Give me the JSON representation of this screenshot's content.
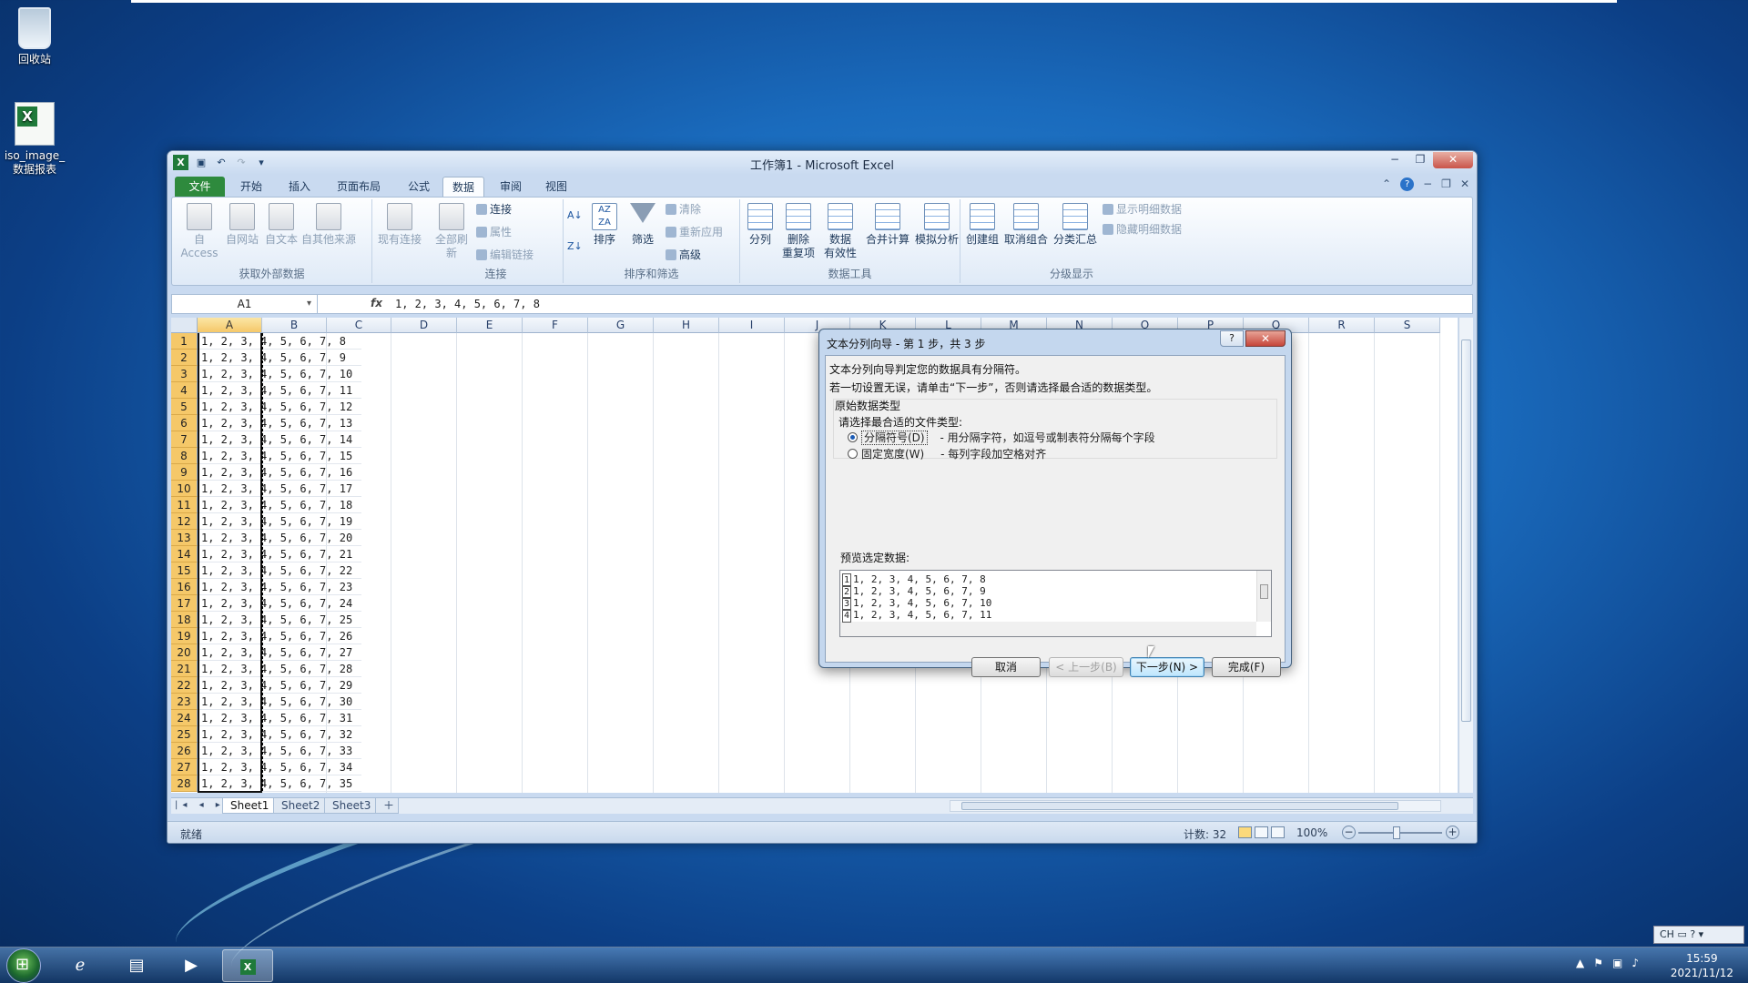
{
  "desktop": {
    "icons": [
      {
        "label": "回收站"
      },
      {
        "label": "iso_image_数据报表"
      }
    ]
  },
  "window": {
    "title": "工作簿1 - Microsoft Excel",
    "controls": {
      "minimize": "−",
      "restore": "❐",
      "close": "✕"
    }
  },
  "ribbon_tabs": {
    "file": "文件",
    "home": "开始",
    "insert": "插入",
    "page_layout": "页面布局",
    "formulas": "公式",
    "data": "数据",
    "review": "审阅",
    "view": "视图"
  },
  "ribbon": {
    "get_external": {
      "label": "获取外部数据",
      "access": "自 Access",
      "web": "自网站",
      "text": "自文本",
      "other": "自其他来源",
      "existing": "现有连接"
    },
    "connections": {
      "label": "连接",
      "refresh_all": "全部刷新",
      "connections": "连接",
      "properties": "属性",
      "edit_links": "编辑链接"
    },
    "sort_filter": {
      "label": "排序和筛选",
      "sort": "排序",
      "filter": "筛选",
      "clear": "清除",
      "reapply": "重新应用",
      "advanced": "高级"
    },
    "data_tools": {
      "label": "数据工具",
      "text_to_columns": "分列",
      "remove_dup_1": "删除",
      "remove_dup_2": "重复项",
      "validation_1": "数据",
      "validation_2": "有效性",
      "consolidate": "合并计算",
      "what_if": "模拟分析"
    },
    "outline": {
      "label": "分级显示",
      "group": "创建组",
      "ungroup": "取消组合",
      "subtotal": "分类汇总",
      "show_detail": "显示明细数据",
      "hide_detail": "隐藏明细数据"
    }
  },
  "formula_bar": {
    "name_box": "A1",
    "fx": "fx",
    "value": "1, 2, 3, 4, 5, 6, 7, 8"
  },
  "columns": [
    "A",
    "B",
    "C",
    "D",
    "E",
    "F",
    "G",
    "H",
    "I",
    "J",
    "K",
    "L",
    "M",
    "N",
    "O",
    "P",
    "Q",
    "R",
    "S"
  ],
  "rows": [
    {
      "n": "1",
      "v": "1, 2, 3, 4, 5, 6, 7, 8"
    },
    {
      "n": "2",
      "v": "1, 2, 3, 4, 5, 6, 7, 9"
    },
    {
      "n": "3",
      "v": "1, 2, 3, 4, 5, 6, 7, 10"
    },
    {
      "n": "4",
      "v": "1, 2, 3, 4, 5, 6, 7, 11"
    },
    {
      "n": "5",
      "v": "1, 2, 3, 4, 5, 6, 7, 12"
    },
    {
      "n": "6",
      "v": "1, 2, 3, 4, 5, 6, 7, 13"
    },
    {
      "n": "7",
      "v": "1, 2, 3, 4, 5, 6, 7, 14"
    },
    {
      "n": "8",
      "v": "1, 2, 3, 4, 5, 6, 7, 15"
    },
    {
      "n": "9",
      "v": "1, 2, 3, 4, 5, 6, 7, 16"
    },
    {
      "n": "10",
      "v": "1, 2, 3, 4, 5, 6, 7, 17"
    },
    {
      "n": "11",
      "v": "1, 2, 3, 4, 5, 6, 7, 18"
    },
    {
      "n": "12",
      "v": "1, 2, 3, 4, 5, 6, 7, 19"
    },
    {
      "n": "13",
      "v": "1, 2, 3, 4, 5, 6, 7, 20"
    },
    {
      "n": "14",
      "v": "1, 2, 3, 4, 5, 6, 7, 21"
    },
    {
      "n": "15",
      "v": "1, 2, 3, 4, 5, 6, 7, 22"
    },
    {
      "n": "16",
      "v": "1, 2, 3, 4, 5, 6, 7, 23"
    },
    {
      "n": "17",
      "v": "1, 2, 3, 4, 5, 6, 7, 24"
    },
    {
      "n": "18",
      "v": "1, 2, 3, 4, 5, 6, 7, 25"
    },
    {
      "n": "19",
      "v": "1, 2, 3, 4, 5, 6, 7, 26"
    },
    {
      "n": "20",
      "v": "1, 2, 3, 4, 5, 6, 7, 27"
    },
    {
      "n": "21",
      "v": "1, 2, 3, 4, 5, 6, 7, 28"
    },
    {
      "n": "22",
      "v": "1, 2, 3, 4, 5, 6, 7, 29"
    },
    {
      "n": "23",
      "v": "1, 2, 3, 4, 5, 6, 7, 30"
    },
    {
      "n": "24",
      "v": "1, 2, 3, 4, 5, 6, 7, 31"
    },
    {
      "n": "25",
      "v": "1, 2, 3, 4, 5, 6, 7, 32"
    },
    {
      "n": "26",
      "v": "1, 2, 3, 4, 5, 6, 7, 33"
    },
    {
      "n": "27",
      "v": "1, 2, 3, 4, 5, 6, 7, 34"
    },
    {
      "n": "28",
      "v": "1, 2, 3, 4, 5, 6, 7, 35"
    }
  ],
  "sheets": [
    "Sheet1",
    "Sheet2",
    "Sheet3"
  ],
  "status": {
    "ready": "就绪",
    "count": "计数: 32",
    "zoom": "100%"
  },
  "dialog": {
    "title": "文本分列向导 - 第 1 步，共 3 步",
    "help": "?",
    "close": "✕",
    "line1": "文本分列向导判定您的数据具有分隔符。",
    "line2": "若一切设置无误，请单击“下一步”，否则请选择最合适的数据类型。",
    "group_title": "原始数据类型",
    "prompt": "请选择最合适的文件类型:",
    "opt_delimited": "分隔符号(D)",
    "opt_delimited_desc": "- 用分隔字符，如逗号或制表符分隔每个字段",
    "opt_fixed": "固定宽度(W)",
    "opt_fixed_desc": "- 每列字段加空格对齐",
    "preview_label": "预览选定数据:",
    "preview": [
      {
        "n": "1",
        "v": "1, 2, 3, 4, 5, 6, 7, 8"
      },
      {
        "n": "2",
        "v": "1, 2, 3, 4, 5, 6, 7, 9"
      },
      {
        "n": "3",
        "v": "1, 2, 3, 4, 5, 6, 7, 10"
      },
      {
        "n": "4",
        "v": "1, 2, 3, 4, 5, 6, 7, 11"
      }
    ],
    "buttons": {
      "cancel": "取消",
      "back": "< 上一步(B)",
      "next": "下一步(N) >",
      "finish": "完成(F)"
    }
  },
  "taskbar": {
    "time": "15:59",
    "date": "2021/11/12",
    "lang": "CH"
  },
  "colors": {
    "excel_green": "#1f7a3a",
    "selection_header": "#f5c869",
    "window_frame": "#c9daf0"
  }
}
